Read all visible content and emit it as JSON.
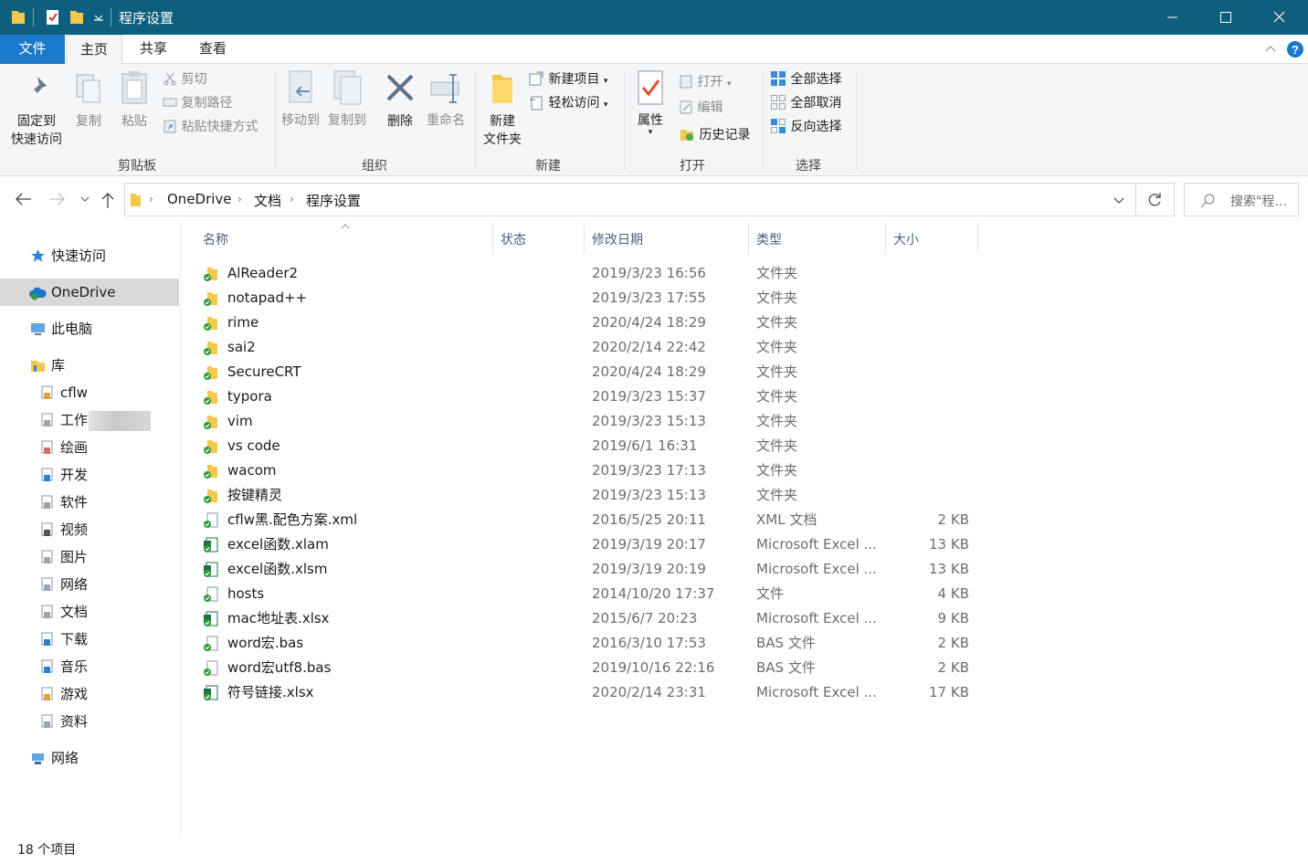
{
  "window": {
    "title": "程序设置"
  },
  "tabs": {
    "file": "文件",
    "home": "主页",
    "share": "共享",
    "view": "查看"
  },
  "ribbon": {
    "pin": [
      "固定到",
      "快速访问"
    ],
    "copy": "复制",
    "paste": "粘贴",
    "cut": "剪切",
    "copy_path": "复制路径",
    "paste_shortcut": "粘贴快捷方式",
    "clipboard_group": "剪贴板",
    "move_to": "移动到",
    "copy_to": "复制到",
    "delete": "删除",
    "rename": "重命名",
    "organize_group": "组织",
    "new_folder": [
      "新建",
      "文件夹"
    ],
    "new_item": "新建项目",
    "easy_access": "轻松访问",
    "new_group": "新建",
    "properties": "属性",
    "open": "打开",
    "edit": "编辑",
    "history": "历史记录",
    "open_group": "打开",
    "select_all": "全部选择",
    "select_none": "全部取消",
    "invert_selection": "反向选择",
    "select_group": "选择"
  },
  "address": {
    "crumbs": [
      "OneDrive",
      "文档",
      "程序设置"
    ],
    "search_placeholder": "搜索\"程..."
  },
  "sidebar": {
    "quick_access": "快速访问",
    "onedrive": "OneDrive",
    "this_pc": "此电脑",
    "libraries": "库",
    "library_items": [
      "cflw",
      "工作",
      "绘画",
      "开发",
      "软件",
      "视频",
      "图片",
      "网络",
      "文档",
      "下载",
      "音乐",
      "游戏",
      "资料"
    ],
    "network": "网络"
  },
  "columns": {
    "name": "名称",
    "status": "状态",
    "date": "修改日期",
    "type": "类型",
    "size": "大小"
  },
  "files": [
    {
      "name": "AlReader2",
      "date": "2019/3/23 16:56",
      "type": "文件夹",
      "size": "",
      "kind": "folder"
    },
    {
      "name": "notapad++",
      "date": "2019/3/23 17:55",
      "type": "文件夹",
      "size": "",
      "kind": "folder"
    },
    {
      "name": "rime",
      "date": "2020/4/24 18:29",
      "type": "文件夹",
      "size": "",
      "kind": "folder"
    },
    {
      "name": "sai2",
      "date": "2020/2/14 22:42",
      "type": "文件夹",
      "size": "",
      "kind": "folder"
    },
    {
      "name": "SecureCRT",
      "date": "2020/4/24 18:29",
      "type": "文件夹",
      "size": "",
      "kind": "folder"
    },
    {
      "name": "typora",
      "date": "2019/3/23 15:37",
      "type": "文件夹",
      "size": "",
      "kind": "folder"
    },
    {
      "name": "vim",
      "date": "2019/3/23 15:13",
      "type": "文件夹",
      "size": "",
      "kind": "folder"
    },
    {
      "name": "vs code",
      "date": "2019/6/1 16:31",
      "type": "文件夹",
      "size": "",
      "kind": "folder"
    },
    {
      "name": "wacom",
      "date": "2019/3/23 17:13",
      "type": "文件夹",
      "size": "",
      "kind": "folder"
    },
    {
      "name": "按键精灵",
      "date": "2019/3/23 15:13",
      "type": "文件夹",
      "size": "",
      "kind": "folder"
    },
    {
      "name": "cflw黑.配色方案.xml",
      "date": "2016/5/25 20:11",
      "type": "XML 文档",
      "size": "2 KB",
      "kind": "file"
    },
    {
      "name": "excel函数.xlam",
      "date": "2019/3/19 20:17",
      "type": "Microsoft Excel ...",
      "size": "13 KB",
      "kind": "excel"
    },
    {
      "name": "excel函数.xlsm",
      "date": "2019/3/19 20:19",
      "type": "Microsoft Excel ...",
      "size": "13 KB",
      "kind": "excel"
    },
    {
      "name": "hosts",
      "date": "2014/10/20 17:37",
      "type": "文件",
      "size": "4 KB",
      "kind": "file"
    },
    {
      "name": "mac地址表.xlsx",
      "date": "2015/6/7 20:23",
      "type": "Microsoft Excel ...",
      "size": "9 KB",
      "kind": "excel"
    },
    {
      "name": "word宏.bas",
      "date": "2016/3/10 17:53",
      "type": "BAS 文件",
      "size": "2 KB",
      "kind": "file"
    },
    {
      "name": "word宏utf8.bas",
      "date": "2019/10/16 22:16",
      "type": "BAS 文件",
      "size": "2 KB",
      "kind": "file"
    },
    {
      "name": "符号链接.xlsx",
      "date": "2020/2/14 23:31",
      "type": "Microsoft Excel ...",
      "size": "17 KB",
      "kind": "excel"
    }
  ],
  "status": {
    "count": "18 个项目"
  },
  "colors": {
    "titlebar": "#0e5e7d",
    "file_tab": "#1979ca",
    "folder": "#f3c84f",
    "sync_green": "#2e9b3c",
    "excel": "#1f7244"
  }
}
